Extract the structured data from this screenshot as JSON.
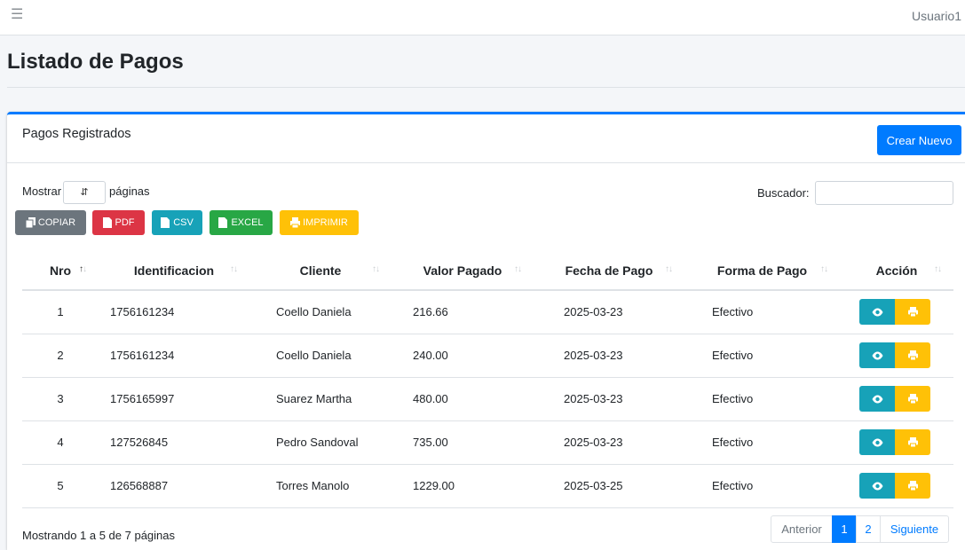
{
  "topbar": {
    "menu_icon": "hamburger-icon",
    "user": "Usuario1"
  },
  "page": {
    "title": "Listado de Pagos"
  },
  "card": {
    "title": "Pagos Registrados",
    "create_button": "Crear Nuevo",
    "accent_color": "#007bff"
  },
  "controls": {
    "show_label": "Mostrar",
    "show_suffix": "páginas",
    "search_label": "Buscador:",
    "search_value": ""
  },
  "export_buttons": {
    "copy": "COPIAR",
    "pdf": "PDF",
    "csv": "CSV",
    "excel": "EXCEL",
    "print": "IMPRIMIR"
  },
  "table": {
    "headers": [
      "Nro",
      "Identificacion",
      "Cliente",
      "Valor Pagado",
      "Fecha de Pago",
      "Forma de Pago",
      "Acción"
    ],
    "rows": [
      [
        "1",
        "1756161234",
        "Coello Daniela",
        "216.66",
        "2025-03-23",
        "Efectivo"
      ],
      [
        "2",
        "1756161234",
        "Coello Daniela",
        "240.00",
        "2025-03-23",
        "Efectivo"
      ],
      [
        "3",
        "1756165997",
        "Suarez Martha",
        "480.00",
        "2025-03-23",
        "Efectivo"
      ],
      [
        "4",
        "127526845",
        "Pedro Sandoval",
        "735.00",
        "2025-03-23",
        "Efectivo"
      ],
      [
        "5",
        "126568887",
        "Torres Manolo",
        "1229.00",
        "2025-03-25",
        "Efectivo"
      ]
    ]
  },
  "footer": {
    "info": "Mostrando 1 a 5 de 7 páginas",
    "prev": "Anterior",
    "page1": "1",
    "page2": "2",
    "next": "Siguiente"
  }
}
